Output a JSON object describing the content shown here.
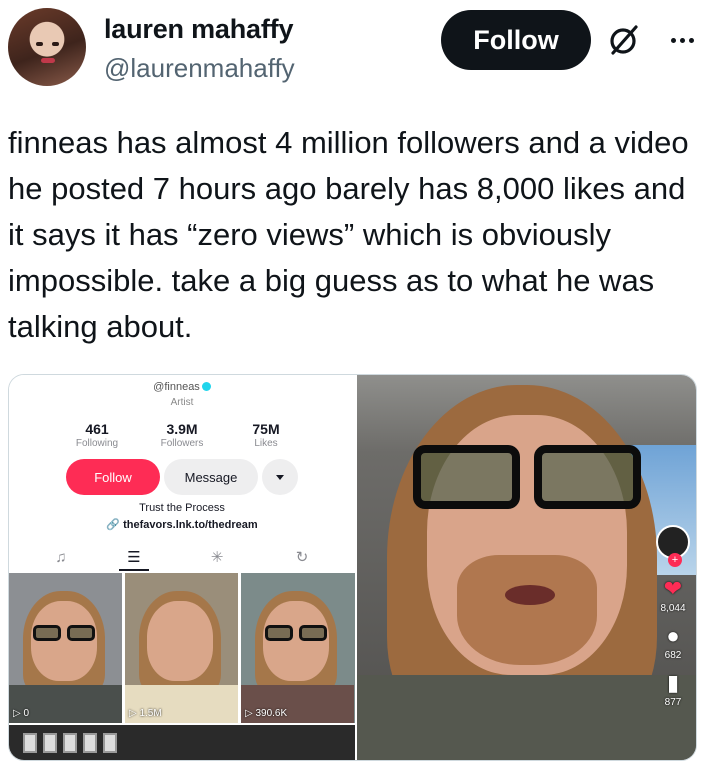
{
  "tweet": {
    "author": {
      "display_name": "lauren mahaffy",
      "handle": "@laurenmahaffy"
    },
    "follow_label": "Follow",
    "icons": {
      "grok": "grok-slash-icon",
      "more": "more-dots-icon"
    },
    "text": "finneas has almost 4 million followers and a video he posted 7 hours ago barely has 8,000 likes and it says it has “zero views” which is obviously impossible. take a big guess as to what he was talking about."
  },
  "tiktok_profile": {
    "handle": "@finneas",
    "category": "Artist",
    "stats": [
      {
        "value": "461",
        "label": "Following"
      },
      {
        "value": "3.9M",
        "label": "Followers"
      },
      {
        "value": "75M",
        "label": "Likes"
      }
    ],
    "follow_label": "Follow",
    "message_label": "Message",
    "bio": "Trust the Process",
    "link": "thefavors.lnk.to/thedream",
    "video_counts": [
      "0",
      "1.5M",
      "390.6K"
    ],
    "accent_color": "#fe2c55"
  },
  "tiktok_video": {
    "likes": "8,044",
    "comments": "682",
    "saves": "877"
  }
}
